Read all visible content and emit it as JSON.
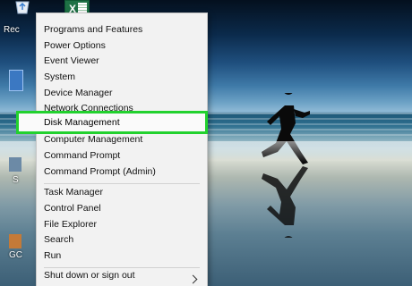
{
  "desktop": {
    "recycle_bin_label": "Rec",
    "excel_letter": "X",
    "side_label_s": "S",
    "side_label_cc": "GC"
  },
  "menu": {
    "items": [
      "Programs and Features",
      "Power Options",
      "Event Viewer",
      "System",
      "Device Manager",
      "Network Connections",
      "Disk Management",
      "Computer Management",
      "Command Prompt",
      "Command Prompt (Admin)",
      "Task Manager",
      "Control Panel",
      "File Explorer",
      "Search",
      "Run",
      "Shut down or sign out"
    ],
    "highlighted_index": 6,
    "highlight_color": "#22d12e"
  }
}
